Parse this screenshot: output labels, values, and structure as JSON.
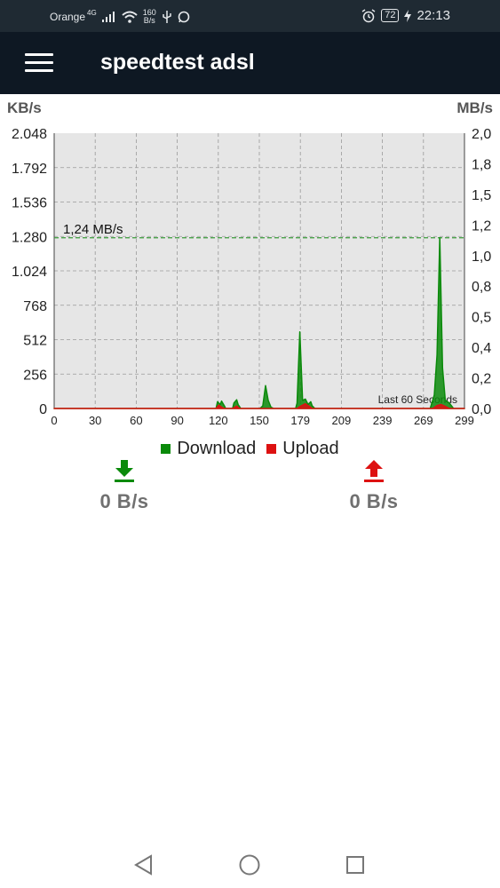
{
  "status_bar": {
    "carrier": "Orange",
    "network": "4G",
    "data_speed_value": "160",
    "data_speed_unit": "B/s",
    "battery": "72",
    "time": "22:13",
    "icons": [
      "signal-icon",
      "wifi-icon",
      "usb-icon",
      "whatsapp-icon",
      "alarm-icon",
      "battery-icon",
      "charging-icon"
    ]
  },
  "app_bar": {
    "title": "speedtest adsl",
    "menu_icon": "hamburger-menu-icon"
  },
  "chart_data": {
    "type": "line",
    "ylabel_left": "KB/s",
    "ylabel_right": "MB/s",
    "x_ticks": [
      "0",
      "30",
      "60",
      "90",
      "120",
      "150",
      "179",
      "209",
      "239",
      "269",
      "299"
    ],
    "y_ticks_left": [
      "0",
      "256",
      "512",
      "768",
      "1.024",
      "1.280",
      "1.536",
      "1.792",
      "2.048"
    ],
    "y_ticks_right": [
      "0,0",
      "0,2",
      "0,4",
      "0,5",
      "0,8",
      "1,0",
      "1,2",
      "1,5",
      "1,8",
      "2,0"
    ],
    "xlim": [
      0,
      299
    ],
    "ylim": [
      0,
      2048
    ],
    "grid": true,
    "background": "#e6e6e6",
    "peak_line": {
      "value": 1270,
      "label": "1,24 MB/s"
    },
    "annotation": "Last 60 Seconds",
    "series": [
      {
        "name": "Download",
        "color": "#0a8a0a",
        "x": [
          0,
          118,
          119,
          121,
          122,
          124,
          125,
          130,
          131,
          133,
          134,
          136,
          150,
          152,
          154,
          156,
          158,
          160,
          176,
          177,
          179,
          181,
          183,
          185,
          187,
          188,
          190,
          274,
          277,
          279,
          281,
          283,
          285,
          288,
          291,
          299
        ],
        "y": [
          0,
          0,
          50,
          30,
          55,
          20,
          0,
          0,
          40,
          65,
          30,
          0,
          0,
          20,
          170,
          60,
          10,
          0,
          0,
          40,
          570,
          60,
          70,
          30,
          50,
          20,
          0,
          0,
          100,
          400,
          1270,
          300,
          60,
          40,
          0,
          0
        ]
      },
      {
        "name": "Upload",
        "color": "#dd1111",
        "x": [
          0,
          118,
          120,
          122,
          124,
          130,
          133,
          135,
          177,
          180,
          183,
          186,
          188,
          276,
          279,
          282,
          285,
          288,
          299
        ],
        "y": [
          0,
          0,
          25,
          10,
          0,
          0,
          18,
          0,
          0,
          20,
          35,
          15,
          0,
          0,
          22,
          30,
          15,
          0,
          0
        ]
      }
    ]
  },
  "readouts": {
    "download": {
      "value": "0 B/s",
      "color": "#0a8a0a"
    },
    "upload": {
      "value": "0 B/s",
      "color": "#dd1111"
    }
  },
  "nav_bar": {
    "icons": [
      "back-triangle-icon",
      "home-circle-icon",
      "recents-square-icon"
    ]
  }
}
